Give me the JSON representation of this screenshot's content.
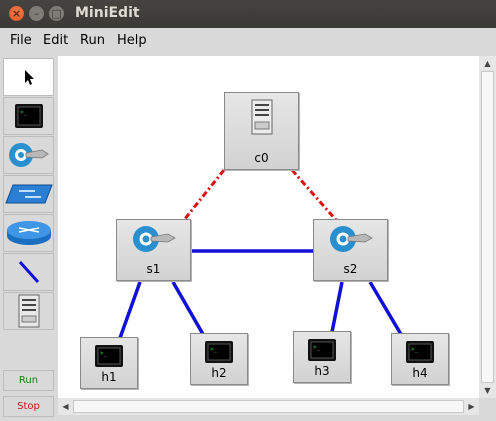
{
  "window": {
    "title": "MiniEdit"
  },
  "menu": {
    "items": [
      "File",
      "Edit",
      "Run",
      "Help"
    ]
  },
  "toolbar": {
    "tools": [
      "select-pointer",
      "host",
      "switch",
      "legacy-switch",
      "legacy-router",
      "link",
      "controller"
    ],
    "run_label": "Run",
    "stop_label": "Stop"
  },
  "topology": {
    "nodes": [
      {
        "id": "c0",
        "label": "c0",
        "type": "controller"
      },
      {
        "id": "s1",
        "label": "s1",
        "type": "switch"
      },
      {
        "id": "s2",
        "label": "s2",
        "type": "switch"
      },
      {
        "id": "h1",
        "label": "h1",
        "type": "host"
      },
      {
        "id": "h2",
        "label": "h2",
        "type": "host"
      },
      {
        "id": "h3",
        "label": "h3",
        "type": "host"
      },
      {
        "id": "h4",
        "label": "h4",
        "type": "host"
      }
    ],
    "links": [
      {
        "from": "c0",
        "to": "s1",
        "style": "controller-dashed"
      },
      {
        "from": "c0",
        "to": "s2",
        "style": "controller-dashed"
      },
      {
        "from": "s1",
        "to": "s2",
        "style": "data"
      },
      {
        "from": "s1",
        "to": "h1",
        "style": "data"
      },
      {
        "from": "s1",
        "to": "h2",
        "style": "data"
      },
      {
        "from": "s2",
        "to": "h3",
        "style": "data"
      },
      {
        "from": "s2",
        "to": "h4",
        "style": "data"
      }
    ]
  },
  "colors": {
    "data_link": "#1010d8",
    "controller_link": "#e01010",
    "run": "#1a7a1a",
    "stop": "#c01818"
  }
}
